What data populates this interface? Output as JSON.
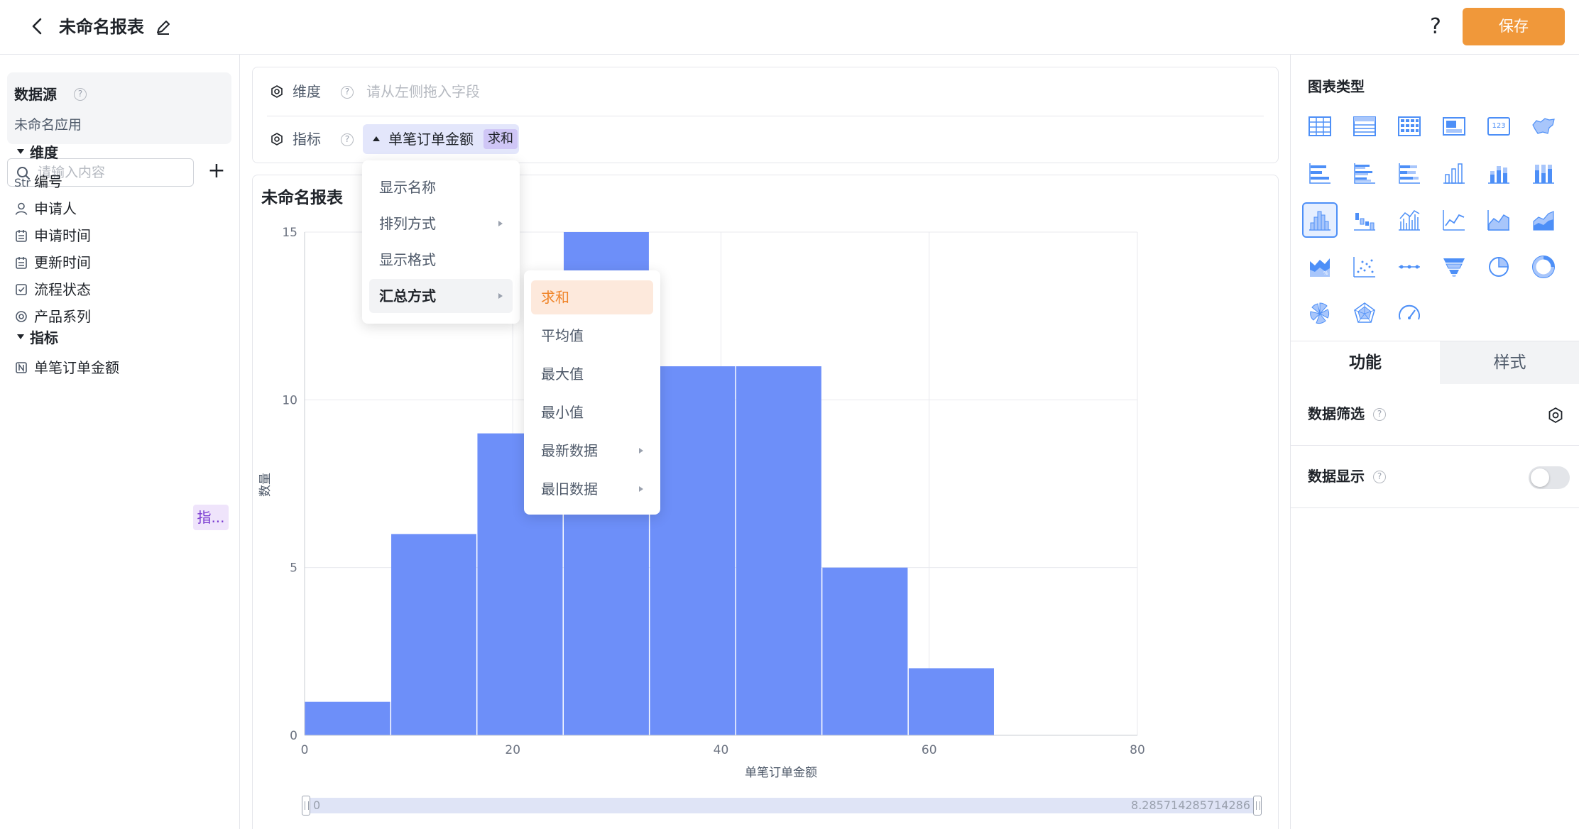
{
  "header": {
    "title": "未命名报表",
    "help": "?",
    "save_label": "保存"
  },
  "left": {
    "datasource_title": "数据源",
    "datasource_name": "未命名应用",
    "search_placeholder": "请输入内容",
    "add": "+",
    "dimension_head": "维度",
    "dimensions": [
      {
        "label": "编号",
        "icon": "string-type-icon",
        "prefix": "Str"
      },
      {
        "label": "申请人",
        "icon": "user-icon"
      },
      {
        "label": "申请时间",
        "icon": "calendar-icon"
      },
      {
        "label": "更新时间",
        "icon": "calendar-icon"
      },
      {
        "label": "流程状态",
        "icon": "checkbox-icon"
      },
      {
        "label": "产品系列",
        "icon": "radio-icon"
      }
    ],
    "metric_head": "指标",
    "metrics": [
      {
        "label": "单笔订单金额",
        "icon": "number-type-icon",
        "tag": "指..."
      }
    ]
  },
  "config": {
    "dimension_label": "维度",
    "dimension_placeholder": "请从左侧拖入字段",
    "metric_label": "指标",
    "metric_chip": "单笔订单金额",
    "metric_agg": "求和"
  },
  "menu": {
    "items": [
      {
        "label": "显示名称",
        "submenu": false
      },
      {
        "label": "排列方式",
        "submenu": true
      },
      {
        "label": "显示格式",
        "submenu": false
      },
      {
        "label": "汇总方式",
        "submenu": true
      }
    ]
  },
  "submenu": {
    "items": [
      {
        "label": "求和",
        "submenu": false,
        "selected": true
      },
      {
        "label": "平均值",
        "submenu": false
      },
      {
        "label": "最大值",
        "submenu": false
      },
      {
        "label": "最小值",
        "submenu": false
      },
      {
        "label": "最新数据",
        "submenu": true
      },
      {
        "label": "最旧数据",
        "submenu": true
      }
    ]
  },
  "chart_data": {
    "type": "bar",
    "title": "未命名报表",
    "xlabel": "单笔订单金额",
    "ylabel": "数量",
    "xlim": [
      0,
      80
    ],
    "ylim": [
      0,
      15
    ],
    "xticks": [
      0,
      20,
      40,
      60,
      80
    ],
    "yticks": [
      0,
      5,
      10,
      15
    ],
    "bins": [
      {
        "x0": 0,
        "x1": 8.29,
        "value": 1
      },
      {
        "x0": 8.29,
        "x1": 16.57,
        "value": 6
      },
      {
        "x0": 16.57,
        "x1": 24.86,
        "value": 9
      },
      {
        "x0": 24.86,
        "x1": 33.14,
        "value": 15
      },
      {
        "x0": 33.14,
        "x1": 41.43,
        "value": 11
      },
      {
        "x0": 41.43,
        "x1": 49.71,
        "value": 11
      },
      {
        "x0": 49.71,
        "x1": 58.0,
        "value": 5
      },
      {
        "x0": 58.0,
        "x1": 66.29,
        "value": 2
      }
    ],
    "bar_color": "#6d8ff9",
    "grid": true,
    "slider_start": "0",
    "slider_end": "8.285714285714286"
  },
  "right": {
    "chart_type_title": "图表类型",
    "tab_function": "功能",
    "tab_style": "样式",
    "filter_label": "数据筛选",
    "display_label": "数据显示",
    "display_enabled": false,
    "chart_types": [
      "table-icon",
      "detail-table-icon",
      "pivot-table-icon",
      "card-icon",
      "number-card-icon",
      "map-icon",
      "bar-horizontal-icon",
      "bar-horizontal-grouped-icon",
      "bar-horizontal-stacked-icon",
      "column-icon",
      "column-stacked-icon",
      "column-percent-icon",
      "histogram-icon",
      "waterfall-icon",
      "column-line-icon",
      "line-icon",
      "area-icon",
      "area-stacked-icon",
      "area-percent-icon",
      "scatter-icon",
      "dot-line-icon",
      "funnel-icon",
      "pie-icon",
      "donut-icon",
      "nightingale-icon",
      "radar-icon",
      "gauge-icon"
    ],
    "active_chart_type": "histogram-icon"
  },
  "colors": {
    "accent": "#f0983a",
    "chart_blue": "#6d8ff9",
    "icon_blue": "#4d8ff7"
  }
}
